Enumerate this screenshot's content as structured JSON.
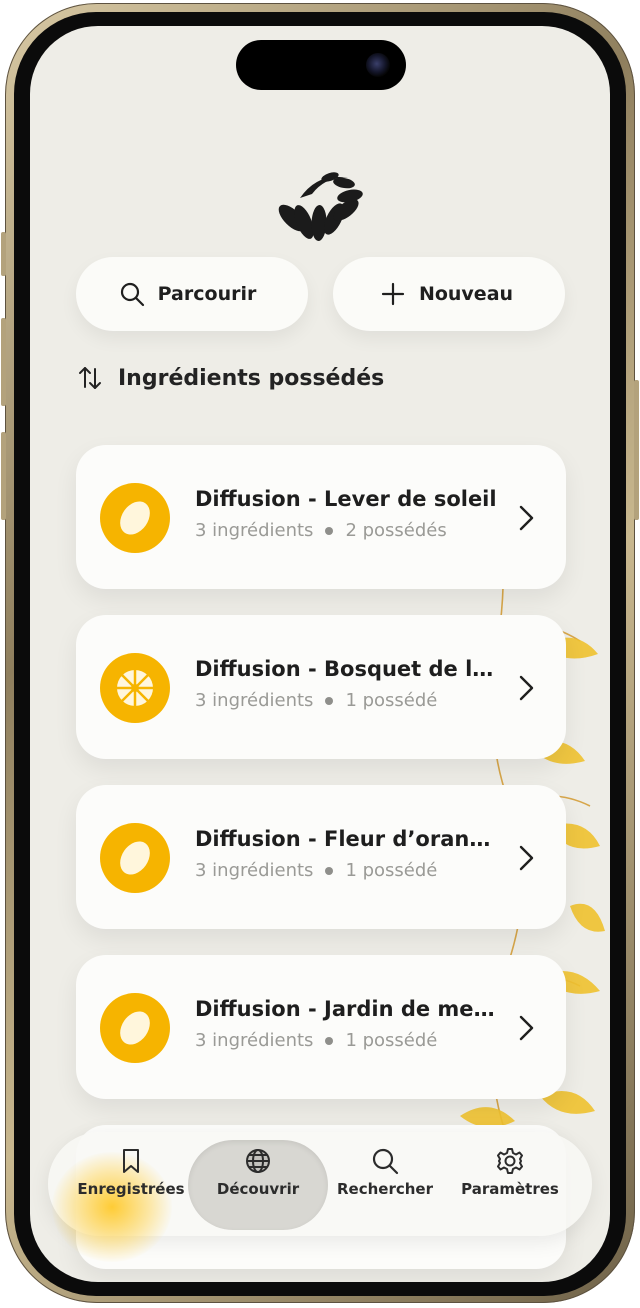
{
  "actions": {
    "browse_label": "Parcourir",
    "new_label": "Nouveau"
  },
  "sort": {
    "label": "Ingrédients possédés"
  },
  "recipes": [
    {
      "title": "Diffusion - Lever de soleil",
      "ingredients": "3 ingrédients",
      "owned": "2 possédés",
      "icon": "lemon-icon"
    },
    {
      "title": "Diffusion - Bosquet de la...",
      "ingredients": "3 ingrédients",
      "owned": "1 possédé",
      "icon": "citrus-slice-icon"
    },
    {
      "title": "Diffusion - Fleur d’oranger",
      "ingredients": "3 ingrédients",
      "owned": "1 possédé",
      "icon": "lemon-icon"
    },
    {
      "title": "Diffusion - Jardin de men...",
      "ingredients": "3 ingrédients",
      "owned": "1 possédé",
      "icon": "lemon-icon"
    }
  ],
  "tabbar": {
    "saved": "Enregistrées",
    "discover": "Découvrir",
    "search": "Rechercher",
    "settings": "Paramètres"
  },
  "colors": {
    "accent": "#f6b400",
    "background": "#eeede7",
    "card": "#fcfcfa"
  }
}
